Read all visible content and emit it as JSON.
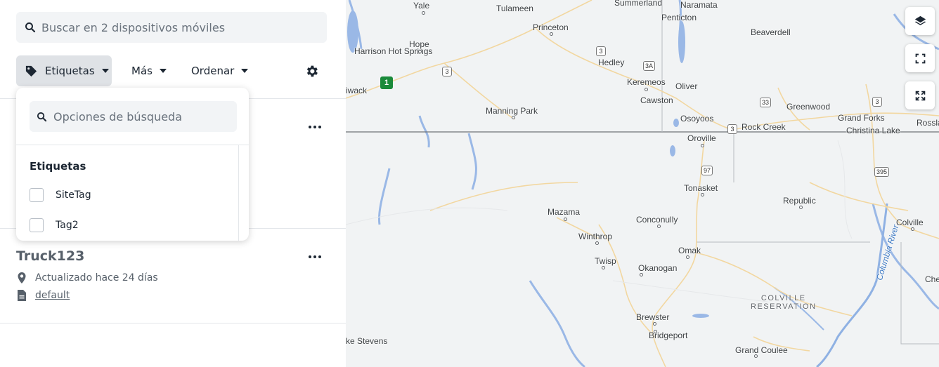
{
  "sidebar": {
    "search": {
      "placeholder": "Buscar en 2 dispositivos móviles",
      "icon": "search-icon"
    },
    "filters": {
      "tags_label": "Etiquetas",
      "more_label": "Más",
      "sort_label": "Ordenar",
      "settings_icon": "gear-icon"
    },
    "devices": [
      {
        "name": "Truck123",
        "updated": "Actualizado hace 24 días",
        "group": "default"
      }
    ]
  },
  "tag_dropdown": {
    "search_placeholder": "Opciones de búsqueda",
    "heading": "Etiquetas",
    "options": [
      {
        "label": "SiteTag",
        "checked": false
      },
      {
        "label": "Tag2",
        "checked": false
      }
    ]
  },
  "map": {
    "controls": [
      "layers-icon",
      "fit-bounds-icon",
      "fullscreen-icon"
    ],
    "places": [
      "Yale",
      "Tulameen",
      "Summerland",
      "Naramata",
      "Penticton",
      "Princeton",
      "Beaverdell",
      "Harrison Hot Springs",
      "Hope",
      "Hedley",
      "Keremeos",
      "Oliver",
      "iwack",
      "Cawston",
      "Greenwood",
      "Grand Forks",
      "Manning Park",
      "Osoyoos",
      "Rock Creek",
      "Christina Lake",
      "Rossla",
      "Oroville",
      "Tonasket",
      "Mazama",
      "Republic",
      "Conconully",
      "Colville",
      "Winthrop",
      "Omak",
      "Twisp",
      "Okanogan",
      "Che",
      "Brewster",
      "Bridgeport",
      "ke Stevens",
      "Grand Coulee"
    ],
    "reservation": "COLVILLE\nRESERVATION",
    "river": "Columbia River",
    "highways": [
      "3",
      "3",
      "3A",
      "33",
      "3",
      "3",
      "97",
      "395",
      "1"
    ]
  }
}
